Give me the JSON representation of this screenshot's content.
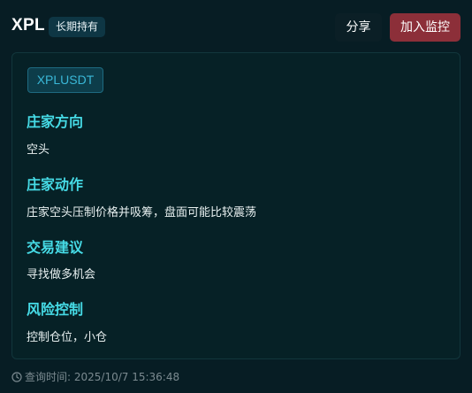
{
  "header": {
    "symbol": "XPL",
    "tag": "长期持有",
    "share_label": "分享",
    "monitor_label": "加入监控"
  },
  "panel": {
    "pair": "XPLUSDT",
    "sections": [
      {
        "title": "庄家方向",
        "text": "空头"
      },
      {
        "title": "庄家动作",
        "text": "庄家空头压制价格并吸筹，盘面可能比较震荡"
      },
      {
        "title": "交易建议",
        "text": "寻找做多机会"
      },
      {
        "title": "风险控制",
        "text": "控制仓位，小仓"
      }
    ]
  },
  "footer": {
    "query_time": "查询时间: 2025/10/7 15:36:48",
    "icon": "clock-icon"
  },
  "colors": {
    "background": "#071d24",
    "accent_title": "#46dbe6",
    "monitor_button": "#8c2f39",
    "pair_text": "#3ab8d8"
  }
}
